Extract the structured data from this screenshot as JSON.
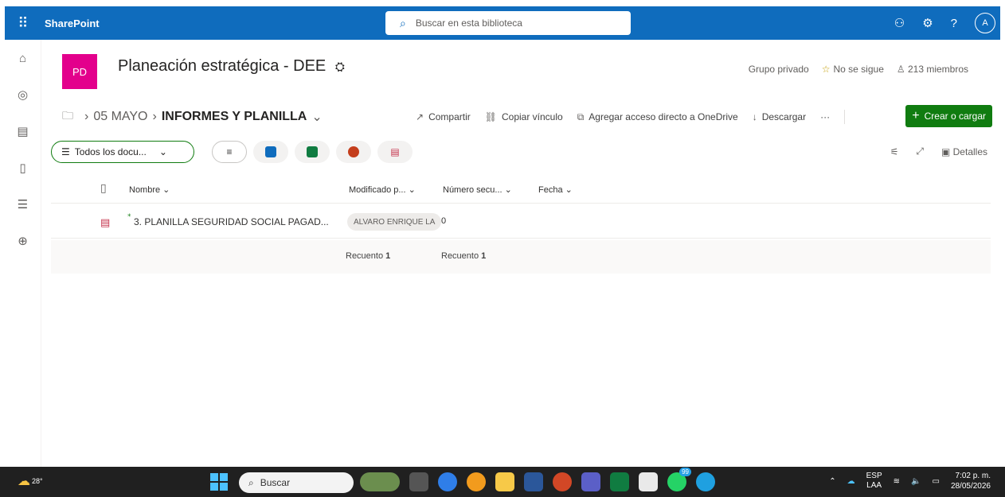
{
  "topbar": {
    "app_name": "SharePoint",
    "search_placeholder": "Buscar en esta biblioteca",
    "avatar_initial": "A",
    "help": "?"
  },
  "site": {
    "logo_initials": "PD",
    "title": "Planeación estratégica - DEE",
    "privacy": "Grupo privado",
    "follow": "No se sigue",
    "members": "213 miembros"
  },
  "breadcrumb": {
    "parent": "05 MAYO",
    "current": "INFORMES Y PLANILLA"
  },
  "commands": {
    "share": "Compartir",
    "copy_link": "Copiar vínculo",
    "add_shortcut": "Agregar acceso directo a OneDrive",
    "download": "Descargar",
    "more": "···",
    "create": "Crear o cargar"
  },
  "view": {
    "selector": "Todos los docu...",
    "details": "Detalles"
  },
  "columns": {
    "name": "Nombre",
    "modified_by": "Modificado p...",
    "sequence": "Número secu...",
    "date": "Fecha"
  },
  "rows": [
    {
      "name": "3. PLANILLA SEGURIDAD SOCIAL PAGAD...",
      "modified_by": "ALVARO ENRIQUE LA",
      "sequence": "0"
    }
  ],
  "footer": {
    "count1_label": "Recuento",
    "count1_value": "1",
    "count2_label": "Recuento",
    "count2_value": "1"
  },
  "taskbar": {
    "weather": "28°",
    "search": "Buscar",
    "lang1": "ESP",
    "lang2": "LAA",
    "time": "7:02 p. m.",
    "date": "28/05/2026",
    "badge": "99"
  },
  "colors": {
    "brand": "#0f6cbd",
    "create": "#107c10",
    "site_logo": "#e3008c"
  }
}
